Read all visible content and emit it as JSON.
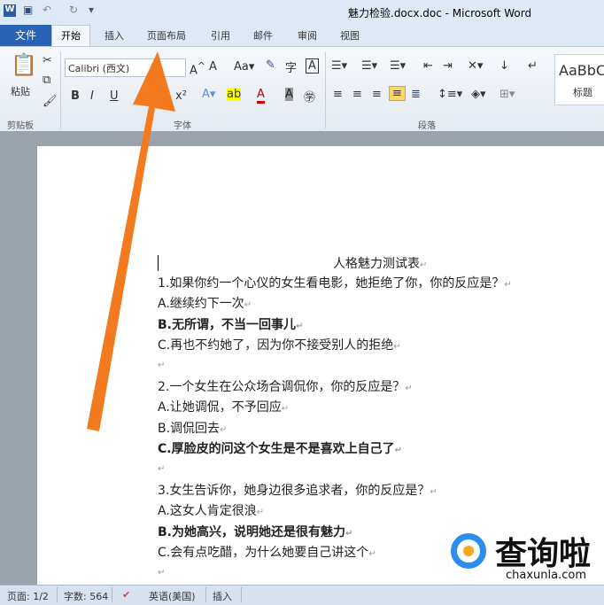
{
  "window": {
    "title": "魅力检验.docx.doc - Microsoft Word"
  },
  "tabs": {
    "file": "文件",
    "items": [
      "开始",
      "插入",
      "页面布局",
      "引用",
      "邮件",
      "审阅",
      "视图"
    ]
  },
  "ribbon": {
    "font_name": "Calibri (西文)",
    "groups": [
      "剪贴板",
      "字体",
      "段落"
    ],
    "paste_label": "粘贴",
    "style_preview": "AaBbC",
    "style_name": "标题"
  },
  "document": {
    "title": "人格魅力测试表",
    "lines": [
      {
        "text": "1.如果你约一个心仪的女生看电影，她拒绝了你，你的反应是？",
        "bold": false
      },
      {
        "text": "A.继续约下一次",
        "bold": false
      },
      {
        "text": "B.无所谓，不当一回事儿",
        "bold": true
      },
      {
        "text": "C.再也不约她了，因为你不接受别人的拒绝",
        "bold": false
      },
      {
        "text": "",
        "bold": false
      },
      {
        "text": "2.一个女生在公众场合调侃你，你的反应是？",
        "bold": false
      },
      {
        "text": "A.让她调侃，不予回应",
        "bold": false
      },
      {
        "text": "B.调侃回去",
        "bold": false
      },
      {
        "text": "C.厚脸皮的问这个女生是不是喜欢上自己了",
        "bold": true
      },
      {
        "text": "",
        "bold": false
      },
      {
        "text": "3.女生告诉你，她身边很多追求者，你的反应是？",
        "bold": false
      },
      {
        "text": "A.这女人肯定很浪",
        "bold": false
      },
      {
        "text": "B.为她高兴，说明她还是很有魅力",
        "bold": true
      },
      {
        "text": "C.会有点吃醋，为什么她要自己讲这个",
        "bold": false
      },
      {
        "text": "",
        "bold": false
      }
    ]
  },
  "status": {
    "page": "页面: 1/2",
    "words": "字数: 564",
    "language": "英语(美国)",
    "mode": "插入"
  },
  "watermark": {
    "name": "查询啦",
    "url": "chaxunla.com"
  },
  "colors": {
    "arrow": "#f47a20",
    "file_tab": "#2a62b5"
  }
}
